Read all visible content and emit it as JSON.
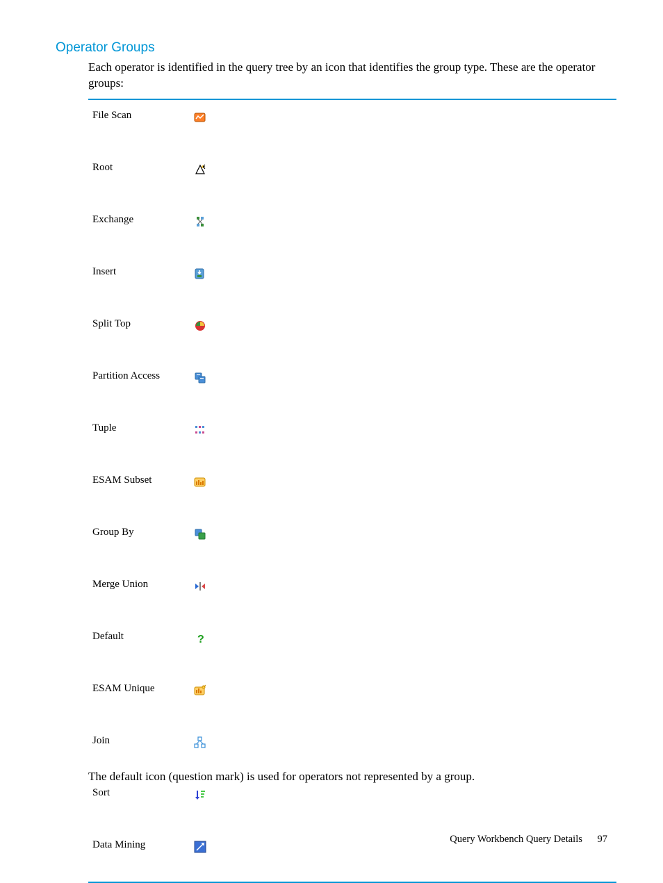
{
  "heading": "Operator Groups",
  "intro": "Each operator is identified in the query tree by an icon that identifies the group type. These are the operator groups:",
  "groups": [
    {
      "label": "File Scan",
      "icon": "file-scan-icon"
    },
    {
      "label": "Root",
      "icon": "root-icon"
    },
    {
      "label": "Exchange",
      "icon": "exchange-icon"
    },
    {
      "label": "Insert",
      "icon": "insert-icon"
    },
    {
      "label": "Split Top",
      "icon": "split-top-icon"
    },
    {
      "label": "Partition Access",
      "icon": "partition-access-icon"
    },
    {
      "label": "Tuple",
      "icon": "tuple-icon"
    },
    {
      "label": "ESAM Subset",
      "icon": "esam-subset-icon"
    },
    {
      "label": "Group By",
      "icon": "group-by-icon"
    },
    {
      "label": "Merge Union",
      "icon": "merge-union-icon"
    },
    {
      "label": "Default",
      "icon": "default-icon"
    },
    {
      "label": "ESAM Unique",
      "icon": "esam-unique-icon"
    },
    {
      "label": "Join",
      "icon": "join-icon"
    },
    {
      "label": "Sort",
      "icon": "sort-icon"
    },
    {
      "label": "Data Mining",
      "icon": "data-mining-icon"
    }
  ],
  "note": "The default icon (question mark) is used for operators not represented by a group.",
  "footer": {
    "section": "Query Workbench Query Details",
    "page": "97"
  }
}
